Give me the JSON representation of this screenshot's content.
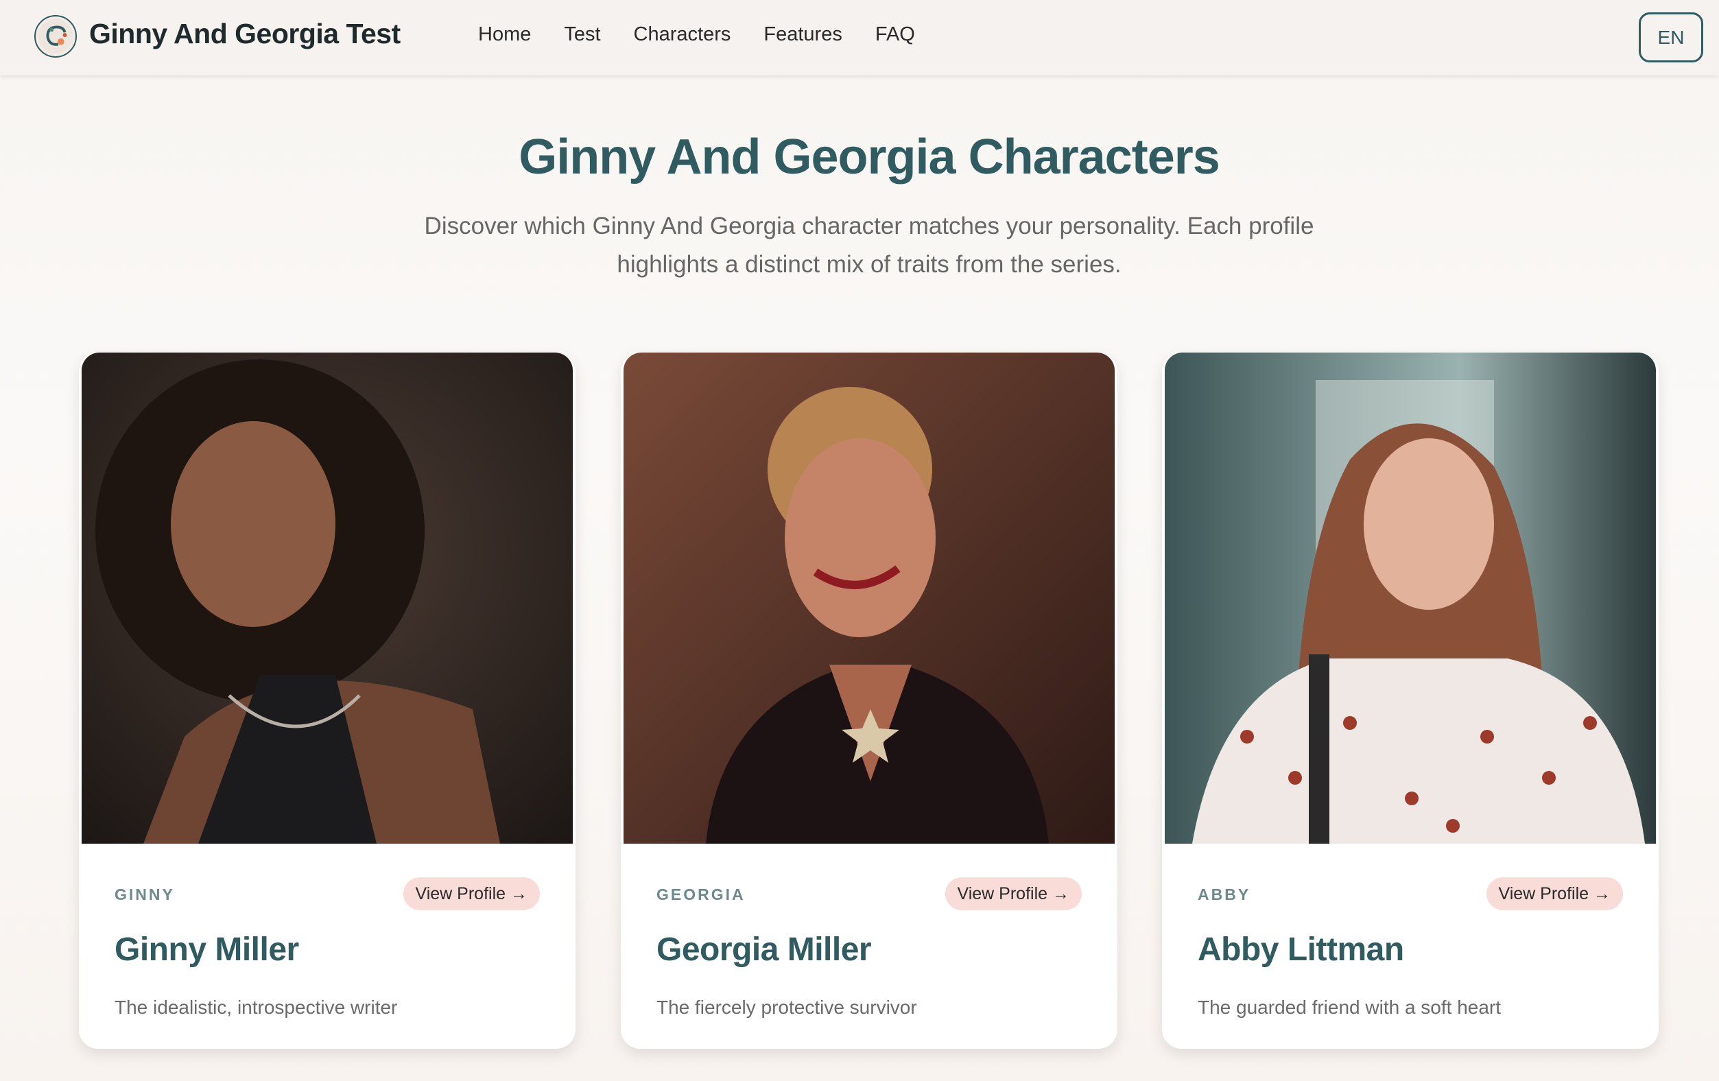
{
  "header": {
    "brand": "Ginny And Georgia Test",
    "nav": [
      "Home",
      "Test",
      "Characters",
      "Features",
      "FAQ"
    ],
    "language": "EN"
  },
  "hero": {
    "title": "Ginny And Georgia Characters",
    "subtitle": "Discover which Ginny And Georgia character matches your personality. Each profile highlights a distinct mix of traits from the series."
  },
  "cards": [
    {
      "short": "GINNY",
      "button": "View Profile →",
      "name": "Ginny Miller",
      "description": "The idealistic, introspective writer"
    },
    {
      "short": "GEORGIA",
      "button": "View Profile →",
      "name": "Georgia Miller",
      "description": "The fiercely protective survivor"
    },
    {
      "short": "ABBY",
      "button": "View Profile →",
      "name": "Abby Littman",
      "description": "The guarded friend with a soft heart"
    }
  ],
  "colors": {
    "accent": "#2f5b61",
    "button_bg": "#f9dcd7",
    "page_bg": "#f8f4f1"
  }
}
